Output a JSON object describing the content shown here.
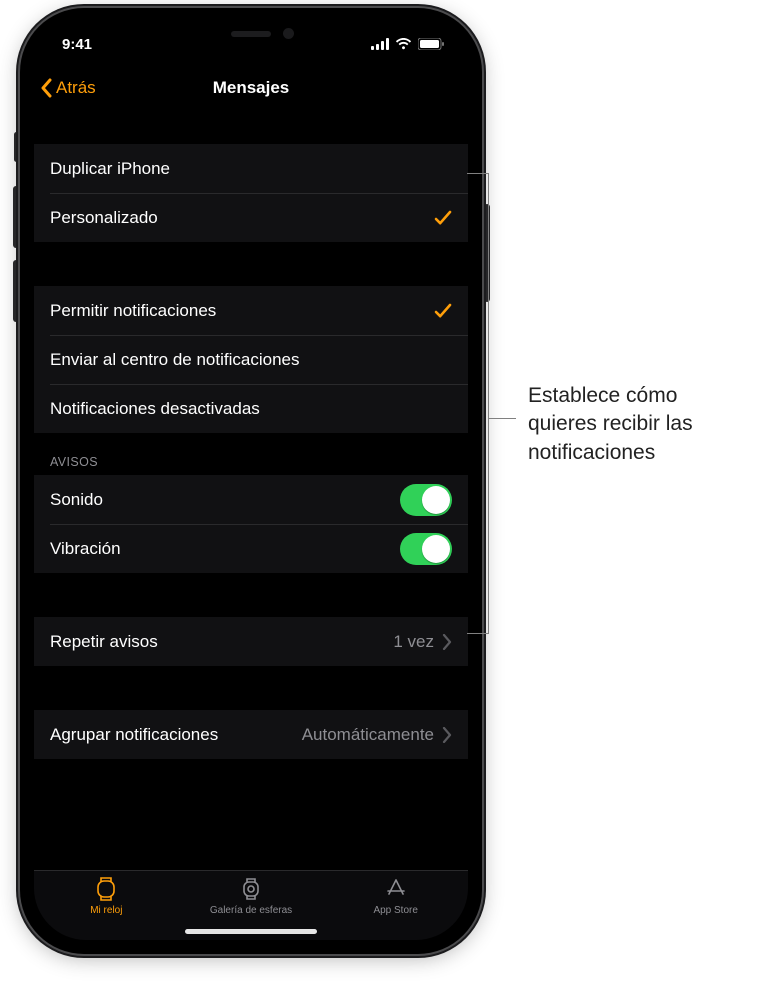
{
  "status_bar": {
    "time": "9:41"
  },
  "navbar": {
    "back_label": "Atrás",
    "title": "Mensajes"
  },
  "groups": {
    "mirror": {
      "duplicate": "Duplicar iPhone",
      "custom": "Personalizado"
    },
    "delivery": {
      "allow": "Permitir notificaciones",
      "send_center": "Enviar al centro de notificaciones",
      "off": "Notificaciones desactivadas"
    },
    "alerts": {
      "header": "AVISOS",
      "sound": "Sonido",
      "haptic": "Vibración"
    },
    "repeat": {
      "label": "Repetir avisos",
      "value": "1 vez"
    },
    "grouping": {
      "label": "Agrupar notificaciones",
      "value": "Automáticamente"
    }
  },
  "tabs": {
    "my_watch": "Mi reloj",
    "gallery": "Galería de esferas",
    "app_store": "App Store"
  },
  "annotation": "Establece cómo quieres recibir las notificaciones"
}
